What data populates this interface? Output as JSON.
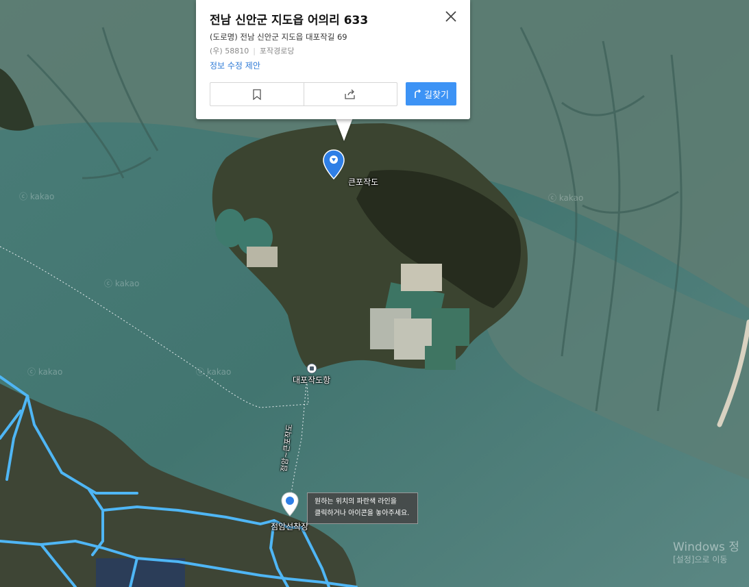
{
  "popup": {
    "title": "전남 신안군 지도읍 어의리 633",
    "road_address": "(도로명) 전남 신안군 지도읍 대포작길 69",
    "zip_label": "(우) 58810",
    "place_name": "포작경로당",
    "edit_link": "정보 수정 제안",
    "route_button": "길찾기",
    "icons": [
      "close-icon",
      "bookmark-icon",
      "share-icon",
      "route-icon"
    ]
  },
  "map": {
    "labels": {
      "island": "큰포작도",
      "port": "대포작도항",
      "ferry_route": "점암~큰포작도",
      "pier": "점암선착장"
    },
    "watermark": "ⓒ kakao",
    "tooltip": {
      "line1": "원하는 위치의 파란색 라인을",
      "line2": "클릭하거나 아이콘을 놓아주세요."
    }
  },
  "os_overlay": {
    "line1": "Windows 정",
    "line2": "[설정]으로 이동"
  },
  "colors": {
    "route_button": "#3d93f5",
    "road_lines": "#4fb6f5",
    "marker": "#2f7fe6",
    "water": "#3f7471",
    "land": "#3c4533"
  }
}
